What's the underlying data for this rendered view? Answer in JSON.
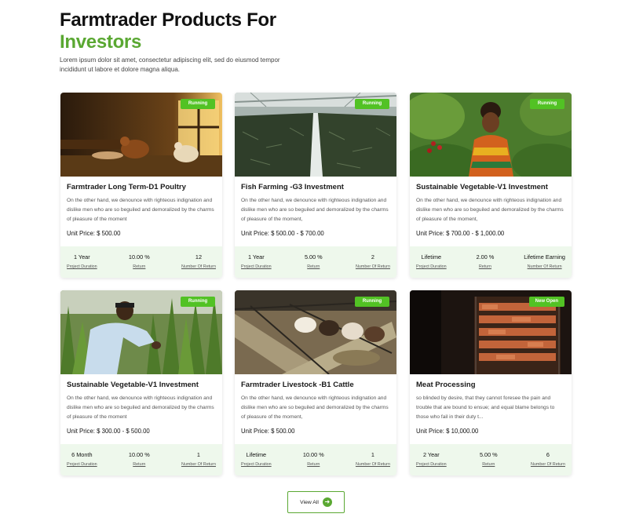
{
  "header": {
    "title_line1": "Farmtrader Products For",
    "title_line2": "Investors",
    "subtitle": "Lorem ipsum dolor sit amet, consectetur adipiscing elit, sed do eiusmod tempor incididunt ut labore et dolore magna aliqua."
  },
  "accent_color": "#5aa832",
  "badge_color": "#52c224",
  "cards": [
    {
      "status": "Running",
      "image": "poultry-chickens-barn",
      "title": "Farmtrader Long Term-D1 Poultry",
      "description": "On the other hand, we denounce with righteous indignation and dislike men who are so beguiled and demoralized by the charms of pleasure of the moment",
      "price": "Unit Price: $ 500.00",
      "stats": [
        {
          "value": "1 Year",
          "label": "Project Duration"
        },
        {
          "value": "10.00 %",
          "label": "Return"
        },
        {
          "value": "12",
          "label": "Number Of Return"
        }
      ]
    },
    {
      "status": "Running",
      "image": "fish-farm-tanks",
      "title": "Fish Farming -G3 Investment",
      "description": "On the other hand, we denounce with righteous indignation and dislike men who are so beguiled and demoralized by the charms of pleasure of the moment,",
      "price": "Unit Price: $ 500.00 - $ 700.00",
      "stats": [
        {
          "value": "1 Year",
          "label": "Project Duration"
        },
        {
          "value": "5.00 %",
          "label": "Return"
        },
        {
          "value": "2",
          "label": "Number Of Return"
        }
      ]
    },
    {
      "status": "Running",
      "image": "woman-harvesting-vegetables",
      "title": "Sustainable Vegetable-V1 Investment",
      "description": "On the other hand, we denounce with righteous indignation and dislike men who are so beguiled and demoralized by the charms of pleasure of the moment,",
      "price": "Unit Price: $ 700.00 - $ 1,000.00",
      "stats": [
        {
          "value": "Lifetime",
          "label": "Project Duration"
        },
        {
          "value": "2.00 %",
          "label": "Return"
        },
        {
          "value": "Lifetime Earning",
          "label": "Number Of Return"
        }
      ]
    },
    {
      "status": "Running",
      "image": "man-in-corn-field",
      "title": "Sustainable Vegetable-V1 Investment",
      "description": "On the other hand, we denounce with righteous indignation and dislike men who are so beguiled and demoralized by the charms of pleasure of the moment",
      "price": "Unit Price: $ 300.00 - $ 500.00",
      "stats": [
        {
          "value": "6 Month",
          "label": "Project Duration"
        },
        {
          "value": "10.00 %",
          "label": "Return"
        },
        {
          "value": "1",
          "label": "Number Of Return"
        }
      ]
    },
    {
      "status": "Running",
      "image": "cattle-feeding-barn",
      "title": "Farmtrader Livestock -B1 Cattle",
      "description": "On the other hand, we denounce with righteous indignation and dislike men who are so beguiled and demoralized by the charms of pleasure of the moment,",
      "price": "Unit Price: $ 500.00",
      "stats": [
        {
          "value": "Lifetime",
          "label": "Project Duration"
        },
        {
          "value": "10.00 %",
          "label": "Return"
        },
        {
          "value": "1",
          "label": "Number Of Return"
        }
      ]
    },
    {
      "status": "New Open",
      "image": "meat-smoking-rack",
      "title": "Meat Processing",
      "description": "so blinded by desire, that they cannot foresee the pain and trouble that are bound to ensue; and equal blame belongs to those who fail in their duty t...",
      "price": "Unit Price: $ 10,000.00",
      "stats": [
        {
          "value": "2 Year",
          "label": "Project Duration"
        },
        {
          "value": "5.00 %",
          "label": "Return"
        },
        {
          "value": "6",
          "label": "Number Of Return"
        }
      ]
    }
  ],
  "view_all": {
    "label": "View All",
    "icon": "arrow-right-icon"
  }
}
